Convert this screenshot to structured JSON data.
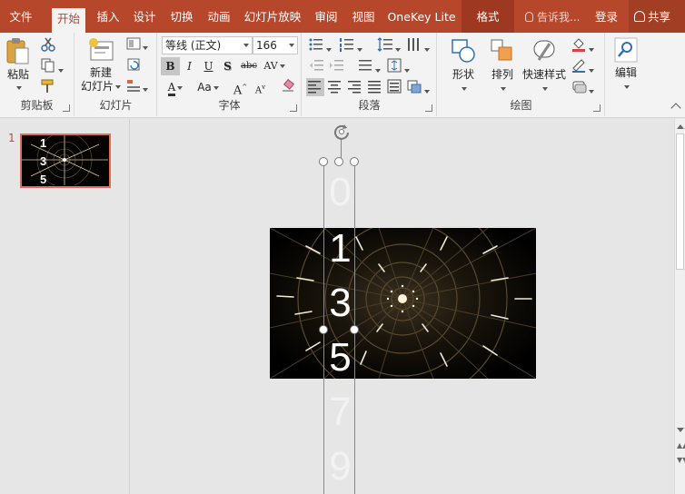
{
  "tabs": [
    {
      "label": "文件"
    },
    {
      "label": "开始"
    },
    {
      "label": "插入"
    },
    {
      "label": "设计"
    },
    {
      "label": "切换"
    },
    {
      "label": "动画"
    },
    {
      "label": "幻灯片放映"
    },
    {
      "label": "审阅"
    },
    {
      "label": "视图"
    },
    {
      "label": "OneKey Lite"
    },
    {
      "label": "格式"
    }
  ],
  "tell_me": "告诉我...",
  "login": "登录",
  "share": "共享",
  "ribbon": {
    "clipboard": {
      "label": "剪贴板",
      "paste": "粘贴"
    },
    "slides": {
      "label": "幻灯片",
      "new_slide": "新建",
      "new_slide_2": "幻灯片"
    },
    "font": {
      "label": "字体",
      "font_name": "等线 (正文)",
      "font_size": "166",
      "bold": "B",
      "italic": "I",
      "underline": "U",
      "shadow": "S",
      "strike": "abc",
      "spacing": "AV",
      "color_a": "A",
      "case": "Aa",
      "grow": "A",
      "shrink": "A"
    },
    "paragraph": {
      "label": "段落"
    },
    "drawing": {
      "label": "绘图",
      "shape": "形状",
      "arrange": "排列",
      "quick_styles": "快速样式"
    },
    "editing": {
      "label": "编辑"
    }
  },
  "thumbnails": [
    {
      "number": "1",
      "digits": [
        "1",
        "3",
        "5"
      ]
    }
  ],
  "textbox_digits": [
    "0",
    "1",
    "3",
    "5",
    "7",
    "9"
  ],
  "colors": {
    "brand": "#b7472a",
    "format_tab": "#9e3820",
    "selected_thumb_border": "#e06e52"
  }
}
